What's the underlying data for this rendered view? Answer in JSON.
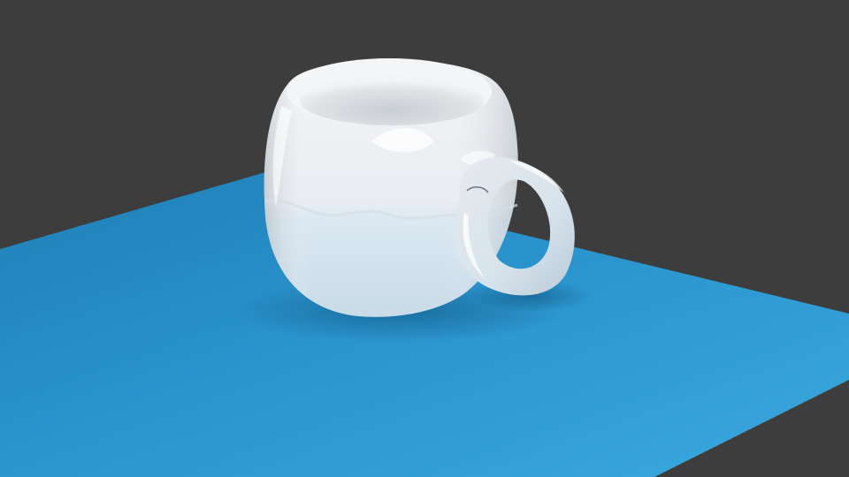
{
  "scene": {
    "subject": "mug",
    "colors": {
      "background": "#3d3d3d",
      "plane_light": "#3aa6dc",
      "plane_dark": "#1b78ac",
      "mug_top": "#eeeff2",
      "mug_bottom": "#cfe1ee",
      "mug_shadow": "#b8c3cc",
      "highlight": "#ffffff"
    }
  }
}
